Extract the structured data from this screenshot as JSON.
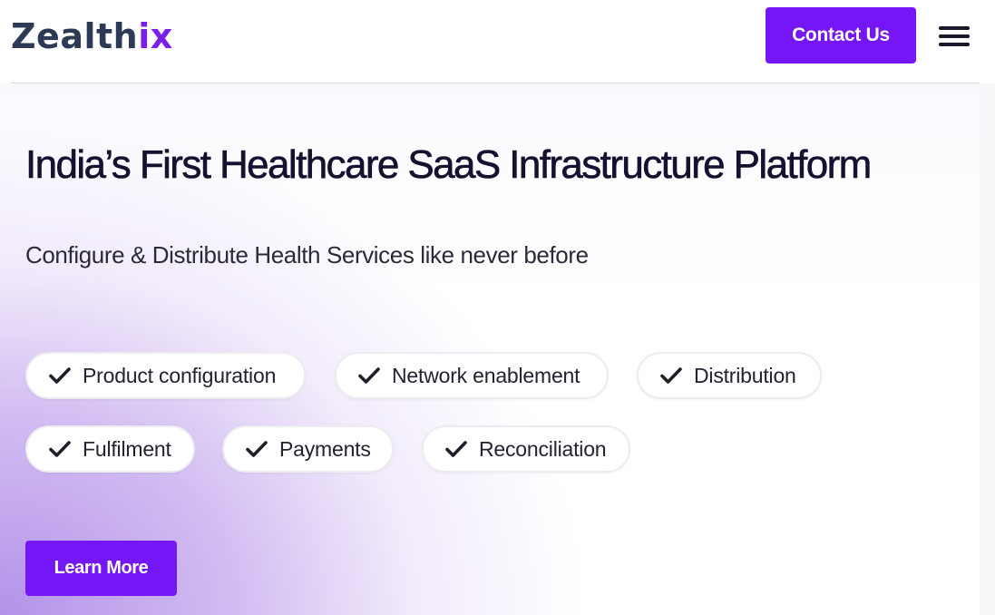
{
  "header": {
    "logo_main": "Zealth",
    "logo_accent": "ix",
    "contact_label": "Contact Us",
    "menu_icon": "hamburger-menu-icon"
  },
  "hero": {
    "title": "India’s First Healthcare SaaS Infrastructure Platform",
    "subtitle": "Configure & Distribute Health Services like never before",
    "features": [
      "Product configuration",
      "Network enablement",
      "Distribution",
      "Fulfilment",
      "Payments",
      "Reconciliation"
    ],
    "feature_icon": "checkmark-icon",
    "learn_more_label": "Learn More"
  },
  "colors": {
    "brand_purple": "#7416f5",
    "logo_dark": "#2d3a55",
    "logo_accent": "#7b1fe8",
    "title_text": "#141230"
  }
}
